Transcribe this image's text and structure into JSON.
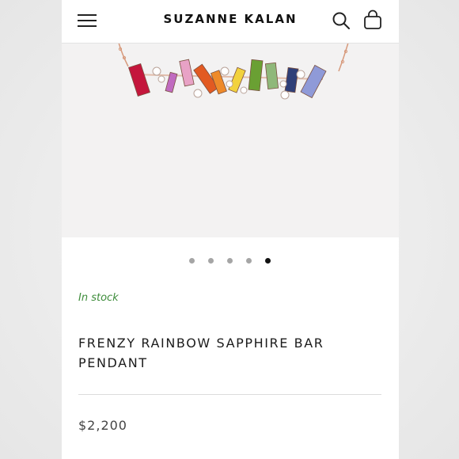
{
  "header": {
    "brand": "SUZANNE KALAN",
    "menu_icon": "hamburger-menu-icon",
    "search_icon": "search-icon",
    "cart_icon": "shopping-bag-icon"
  },
  "gallery": {
    "image_count": 5,
    "active_index": 4
  },
  "product": {
    "stock_status": "In stock",
    "title": "FRENZY RAINBOW SAPPHIRE BAR PENDANT",
    "price": "$2,200"
  },
  "colors": {
    "stock_green": "#3f8d3c",
    "dot_active": "#111111",
    "dot_inactive": "#a5a5a5",
    "chain_rose_gold": "#d79a7c",
    "gem_ruby": "#c4163c",
    "gem_pink": "#e8a2c6",
    "gem_orange": "#e25a22",
    "gem_yellow": "#f2d23e",
    "gem_green": "#6aa033",
    "gem_mint": "#8fb87a",
    "gem_navy": "#2f3f78",
    "gem_periwinkle": "#8f9ad8"
  }
}
